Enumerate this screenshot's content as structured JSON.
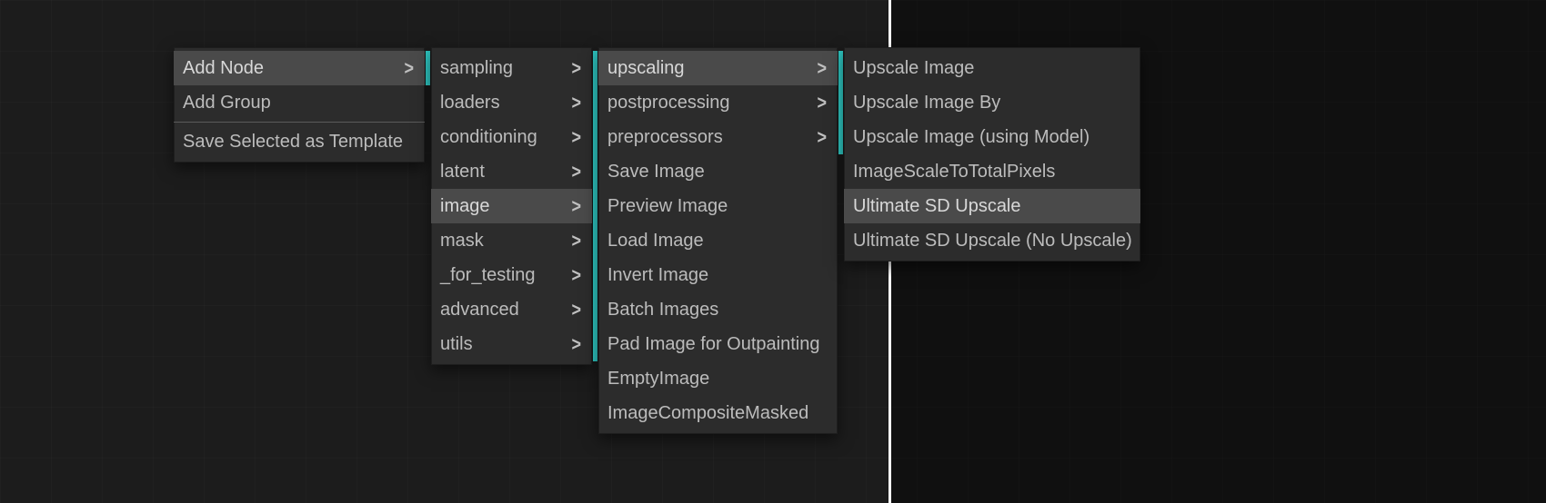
{
  "colors": {
    "accent": "#2ec5c0",
    "menu_bg": "#2c2c2c",
    "text": "#bcbcbc",
    "hover_bg": "#4a4a4a"
  },
  "context_menu": {
    "items": [
      {
        "label": "Add Node",
        "has_submenu": true,
        "active": true
      },
      {
        "label": "Add Group",
        "has_submenu": false
      },
      {
        "label": "Save Selected as Template",
        "has_submenu": false
      }
    ]
  },
  "submenu_categories": {
    "items": [
      {
        "label": "sampling",
        "has_submenu": true
      },
      {
        "label": "loaders",
        "has_submenu": true
      },
      {
        "label": "conditioning",
        "has_submenu": true
      },
      {
        "label": "latent",
        "has_submenu": true
      },
      {
        "label": "image",
        "has_submenu": true,
        "active": true
      },
      {
        "label": "mask",
        "has_submenu": true
      },
      {
        "label": "_for_testing",
        "has_submenu": true
      },
      {
        "label": "advanced",
        "has_submenu": true
      },
      {
        "label": "utils",
        "has_submenu": true
      }
    ]
  },
  "submenu_image": {
    "items": [
      {
        "label": "upscaling",
        "has_submenu": true,
        "active": true
      },
      {
        "label": "postprocessing",
        "has_submenu": true
      },
      {
        "label": "preprocessors",
        "has_submenu": true
      },
      {
        "label": "Save Image",
        "has_submenu": false
      },
      {
        "label": "Preview Image",
        "has_submenu": false
      },
      {
        "label": "Load Image",
        "has_submenu": false
      },
      {
        "label": "Invert Image",
        "has_submenu": false
      },
      {
        "label": "Batch Images",
        "has_submenu": false
      },
      {
        "label": "Pad Image for Outpainting",
        "has_submenu": false
      },
      {
        "label": "EmptyImage",
        "has_submenu": false
      },
      {
        "label": "ImageCompositeMasked",
        "has_submenu": false
      }
    ]
  },
  "submenu_upscaling": {
    "items": [
      {
        "label": "Upscale Image",
        "has_submenu": false
      },
      {
        "label": "Upscale Image By",
        "has_submenu": false
      },
      {
        "label": "Upscale Image (using Model)",
        "has_submenu": false
      },
      {
        "label": "ImageScaleToTotalPixels",
        "has_submenu": false
      },
      {
        "label": "Ultimate SD Upscale",
        "has_submenu": false,
        "active": true
      },
      {
        "label": "Ultimate SD Upscale (No Upscale)",
        "has_submenu": false
      }
    ]
  }
}
